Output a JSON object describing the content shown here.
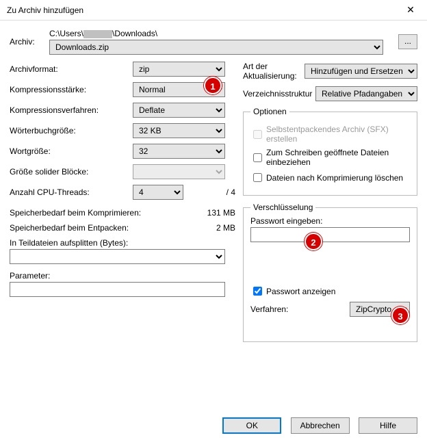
{
  "title": "Zu Archiv hinzufügen",
  "archive": {
    "label": "Archiv:",
    "pathPrefix": "C:\\Users\\",
    "pathSuffix": "\\Downloads\\",
    "filename": "Downloads.zip",
    "browse": "..."
  },
  "format": {
    "label": "Archivformat:",
    "value": "zip"
  },
  "compLevel": {
    "label": "Kompressionsstärke:",
    "value": "Normal"
  },
  "compMethod": {
    "label": "Kompressionsverfahren:",
    "value": "Deflate"
  },
  "dictSize": {
    "label": "Wörterbuchgröße:",
    "value": "32 KB"
  },
  "wordSize": {
    "label": "Wortgröße:",
    "value": "32"
  },
  "solidBlock": {
    "label": "Größe solider Blöcke:",
    "value": ""
  },
  "cpuThreads": {
    "label": "Anzahl CPU-Threads:",
    "value": "4",
    "max": "/ 4"
  },
  "memCompress": {
    "label": "Speicherbedarf beim Komprimieren:",
    "value": "131 MB"
  },
  "memDecompress": {
    "label": "Speicherbedarf beim Entpacken:",
    "value": "2 MB"
  },
  "split": {
    "label": "In Teildateien aufsplitten (Bytes):",
    "value": ""
  },
  "params": {
    "label": "Parameter:",
    "value": ""
  },
  "updateMode": {
    "label": "Art der Aktualisierung:",
    "value": "Hinzufügen und Ersetzen"
  },
  "pathMode": {
    "label": "Verzeichnisstruktur",
    "value": "Relative Pfadangaben"
  },
  "options": {
    "legend": "Optionen",
    "sfx": "Selbstentpackendes Archiv (SFX) erstellen",
    "openShared": "Zum Schreiben geöffnete Dateien einbeziehen",
    "deleteAfter": "Dateien nach Komprimierung löschen"
  },
  "encryption": {
    "legend": "Verschlüsselung",
    "enterPw": "Passwort eingeben:",
    "showPw": "Passwort anzeigen",
    "method": "Verfahren:",
    "methodValue": "ZipCrypto"
  },
  "buttons": {
    "ok": "OK",
    "cancel": "Abbrechen",
    "help": "Hilfe"
  },
  "markers": {
    "m1": "1",
    "m2": "2",
    "m3": "3"
  }
}
